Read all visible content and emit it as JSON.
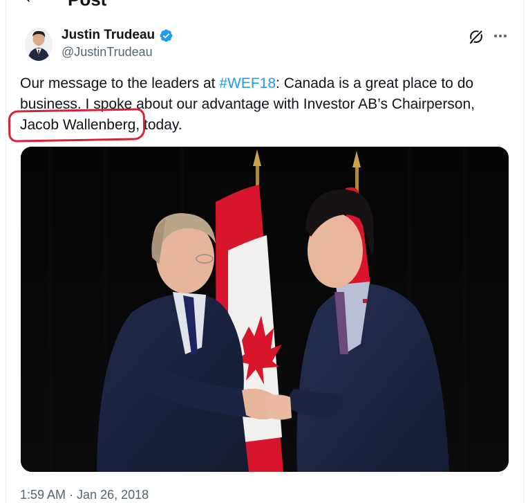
{
  "header": {
    "title": "Post",
    "back_icon": "arrow-left-icon"
  },
  "author": {
    "name": "Justin Trudeau",
    "handle": "@JustinTrudeau",
    "verified_icon": "verified-badge-icon",
    "verified_color": "#1d9bf0"
  },
  "actions": {
    "grok_icon": "grok-icon",
    "more_icon": "more-options-icon"
  },
  "tweet": {
    "text_before_hashtag": "Our message to the leaders at ",
    "hashtag": "#WEF18",
    "text_after_hashtag": ": Canada is a great place to do business. I spoke about our advantage with Investor AB’s Chairperson, ",
    "mention_name": "Jacob Wallenberg",
    "text_end": ", today."
  },
  "media": {
    "kind": "photo"
  },
  "meta": {
    "time": "1:59 AM",
    "separator": "·",
    "date": "Jan 26, 2018"
  },
  "colors": {
    "link": "#1d9bf0",
    "secondary_text": "#536471",
    "annotation": "#d6213a"
  }
}
